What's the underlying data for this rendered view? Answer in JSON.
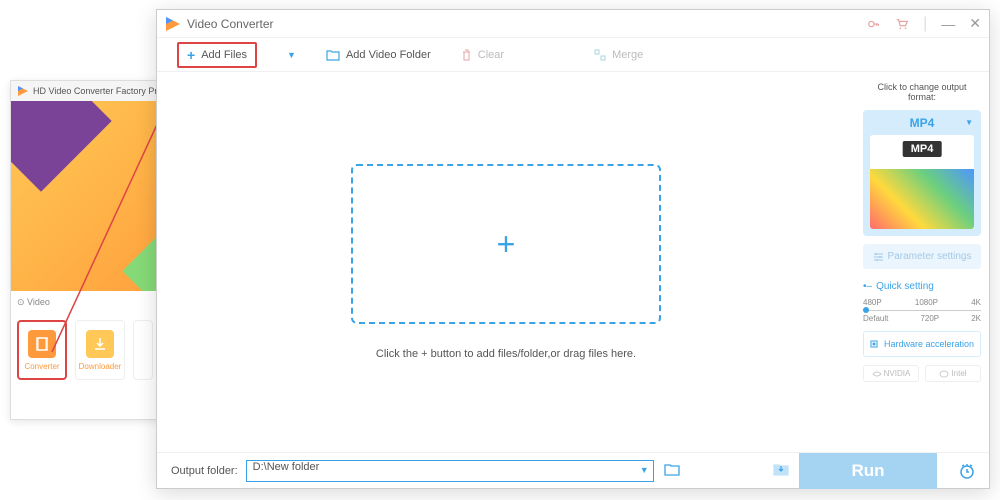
{
  "bg": {
    "title": "HD Video Converter Factory Pro",
    "section_label": "Video",
    "tools": [
      {
        "label": "Converter"
      },
      {
        "label": "Downloader"
      }
    ]
  },
  "window": {
    "title": "Video Converter"
  },
  "toolbar": {
    "add_files": "Add Files",
    "add_folder": "Add Video Folder",
    "clear": "Clear",
    "merge": "Merge"
  },
  "dropzone": {
    "hint": "Click the + button to add files/folder,or drag files here."
  },
  "right": {
    "format_hint": "Click to change output format:",
    "format": "MP4",
    "format_badge": "MP4",
    "param_settings": "Parameter settings",
    "quick_setting": "Quick setting",
    "scale_top": [
      "480P",
      "1080P",
      "4K"
    ],
    "scale_bottom": [
      "Default",
      "720P",
      "2K"
    ],
    "hw_accel": "Hardware acceleration",
    "gpu": [
      "NVIDIA",
      "Intel"
    ]
  },
  "bottom": {
    "output_label": "Output folder:",
    "output_value": "D:\\New folder",
    "run": "Run"
  }
}
